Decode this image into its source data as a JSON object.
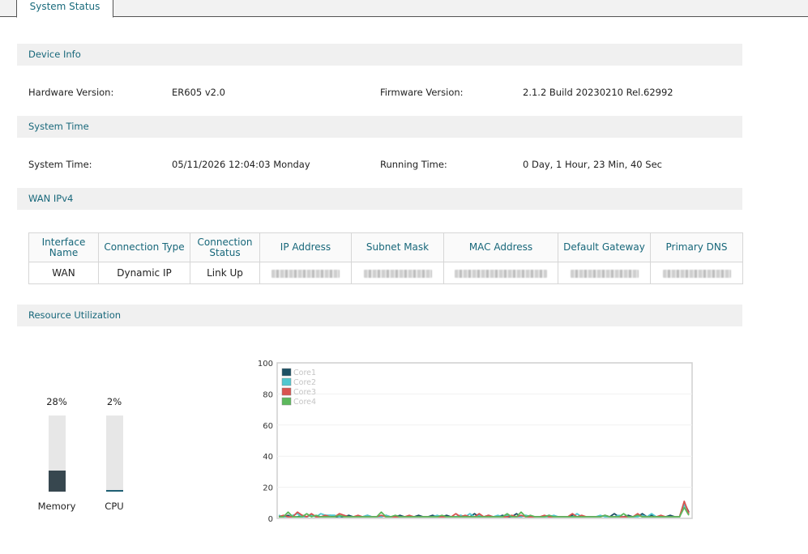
{
  "tab": {
    "label": "System Status"
  },
  "device_info": {
    "title": "Device Info",
    "hardware_label": "Hardware Version:",
    "hardware_value": "ER605 v2.0",
    "firmware_label": "Firmware Version:",
    "firmware_value": "2.1.2 Build 20230210 Rel.62992"
  },
  "system_time": {
    "title": "System Time",
    "time_label": "System Time:",
    "time_value": "05/11/2026 12:04:03 Monday",
    "running_label": "Running Time:",
    "running_value": "0 Day, 1 Hour, 23 Min, 40 Sec"
  },
  "wan": {
    "title": "WAN IPv4",
    "headers": [
      "Interface Name",
      "Connection Type",
      "Connection Status",
      "IP Address",
      "Subnet Mask",
      "MAC Address",
      "Default Gateway",
      "Primary DNS"
    ],
    "row": {
      "name": "WAN",
      "type": "Dynamic IP",
      "status": "Link Up"
    }
  },
  "resource": {
    "title": "Resource Utilization",
    "memory": {
      "label": "Memory",
      "percent_text": "28%",
      "percent": 28,
      "color": "#37474f"
    },
    "cpu": {
      "label": "CPU",
      "percent_text": "2%",
      "percent": 2,
      "color": "#1f5f73"
    }
  },
  "chart_data": {
    "type": "line",
    "ylim": [
      0,
      100
    ],
    "yticks": [
      0,
      20,
      40,
      60,
      80,
      100
    ],
    "legend_placement": "top-left",
    "grid": true,
    "series": [
      {
        "name": "Core1",
        "color": "#1b4f63",
        "values": [
          1,
          1,
          2,
          1,
          1,
          2,
          1,
          2,
          1,
          1,
          1,
          2,
          1,
          1,
          1,
          2,
          1,
          1,
          1,
          2,
          1,
          1,
          1,
          2,
          1,
          1,
          2,
          1,
          1,
          1,
          2,
          1,
          1,
          2,
          1,
          1,
          2,
          1,
          1,
          2,
          1,
          1,
          3,
          1,
          1,
          2,
          1,
          1,
          2,
          1,
          1,
          3,
          1,
          2,
          1,
          1,
          1,
          1,
          2,
          1,
          1,
          1,
          1,
          2,
          1,
          1,
          1,
          1,
          1,
          1,
          2,
          1,
          3,
          1,
          1,
          2,
          1,
          1,
          3,
          1,
          2,
          1,
          1,
          1,
          2,
          1,
          1,
          10,
          4
        ]
      },
      {
        "name": "Core2",
        "color": "#4fc7cf",
        "values": [
          2,
          1,
          1,
          2,
          3,
          1,
          1,
          2,
          1,
          3,
          2,
          2,
          2,
          1,
          2,
          1,
          1,
          1,
          1,
          2,
          1,
          1,
          1,
          2,
          1,
          1,
          1,
          1,
          1,
          1,
          1,
          1,
          1,
          1,
          2,
          1,
          1,
          1,
          1,
          2,
          1,
          3,
          1,
          2,
          1,
          1,
          1,
          2,
          1,
          2,
          1,
          1,
          1,
          2,
          1,
          1,
          1,
          1,
          1,
          2,
          1,
          1,
          1,
          1,
          3,
          1,
          1,
          1,
          1,
          2,
          1,
          1,
          1,
          2,
          1,
          1,
          1,
          1,
          2,
          1,
          3,
          1,
          1,
          1,
          1,
          1,
          1,
          9,
          3
        ]
      },
      {
        "name": "Core3",
        "color": "#d9534f",
        "values": [
          1,
          2,
          1,
          1,
          4,
          2,
          1,
          3,
          1,
          1,
          2,
          1,
          1,
          3,
          2,
          1,
          1,
          2,
          1,
          1,
          1,
          1,
          2,
          1,
          1,
          1,
          1,
          1,
          2,
          1,
          1,
          1,
          1,
          1,
          1,
          1,
          1,
          1,
          3,
          1,
          2,
          1,
          1,
          3,
          1,
          2,
          1,
          1,
          1,
          1,
          2,
          1,
          2,
          1,
          1,
          1,
          1,
          2,
          1,
          1,
          1,
          1,
          1,
          3,
          1,
          2,
          1,
          1,
          1,
          1,
          2,
          1,
          1,
          1,
          1,
          1,
          1,
          3,
          1,
          1,
          1,
          1,
          2,
          1,
          1,
          1,
          1,
          11,
          3
        ]
      },
      {
        "name": "Core4",
        "color": "#5cb85c",
        "values": [
          1,
          1,
          4,
          1,
          1,
          1,
          3,
          1,
          2,
          1,
          1,
          1,
          1,
          2,
          1,
          1,
          1,
          1,
          1,
          1,
          1,
          1,
          4,
          1,
          1,
          2,
          1,
          1,
          1,
          1,
          1,
          1,
          1,
          1,
          1,
          2,
          1,
          1,
          1,
          1,
          1,
          1,
          1,
          1,
          1,
          1,
          1,
          1,
          1,
          3,
          1,
          1,
          4,
          1,
          2,
          1,
          1,
          1,
          2,
          1,
          1,
          1,
          1,
          1,
          1,
          1,
          1,
          1,
          1,
          1,
          2,
          1,
          1,
          1,
          3,
          1,
          1,
          2,
          1,
          1,
          1,
          1,
          1,
          1,
          1,
          1,
          1,
          7,
          2
        ]
      }
    ]
  }
}
